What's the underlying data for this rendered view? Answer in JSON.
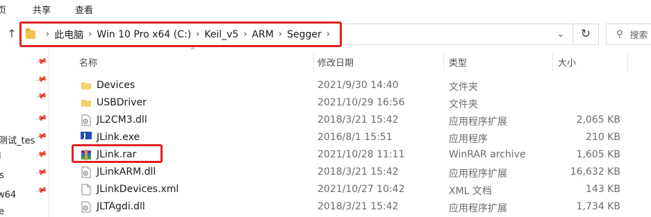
{
  "ribbon": {
    "tabs": [
      "页",
      "共享",
      "查看"
    ]
  },
  "address_bar": {
    "segments": [
      "此电脑",
      "Win 10 Pro x64 (C:)",
      "Keil_v5",
      "ARM",
      "Segger"
    ]
  },
  "search": {
    "placeholder": "搜索"
  },
  "nav_pane": {
    "items": [
      "测试_tes",
      "l",
      "s",
      "w64",
      "e"
    ]
  },
  "columns": {
    "name": "名称",
    "date": "修改日期",
    "type": "类型",
    "size": "大小"
  },
  "files": [
    {
      "name": "Devices",
      "date": "2021/9/30 14:40",
      "type": "文件夹",
      "size": "",
      "icon": "folder-icon"
    },
    {
      "name": "USBDriver",
      "date": "2021/10/29 16:56",
      "type": "文件夹",
      "size": "",
      "icon": "folder-icon"
    },
    {
      "name": "JL2CM3.dll",
      "date": "2018/3/21 15:42",
      "type": "应用程序扩展",
      "size": "2,065 KB",
      "icon": "dll-file-icon"
    },
    {
      "name": "JLink.exe",
      "date": "2016/8/1 15:51",
      "type": "应用程序",
      "size": "210 KB",
      "icon": "jlink-exe-icon"
    },
    {
      "name": "JLink.rar",
      "date": "2021/10/28 11:11",
      "type": "WinRAR archive",
      "size": "1,605 KB",
      "icon": "winrar-archive-icon"
    },
    {
      "name": "JLinkARM.dll",
      "date": "2018/3/21 15:42",
      "type": "应用程序扩展",
      "size": "16,632 KB",
      "icon": "dll-file-icon"
    },
    {
      "name": "JLinkDevices.xml",
      "date": "2021/10/27 10:42",
      "type": "XML 文档",
      "size": "143 KB",
      "icon": "xml-file-icon"
    },
    {
      "name": "JLTAgdi.dll",
      "date": "2018/3/21 15:42",
      "type": "应用程序扩展",
      "size": "1,734 KB",
      "icon": "dll-file-icon"
    }
  ],
  "colors": {
    "highlight": "#e02020",
    "folder": "#f2c14e"
  }
}
